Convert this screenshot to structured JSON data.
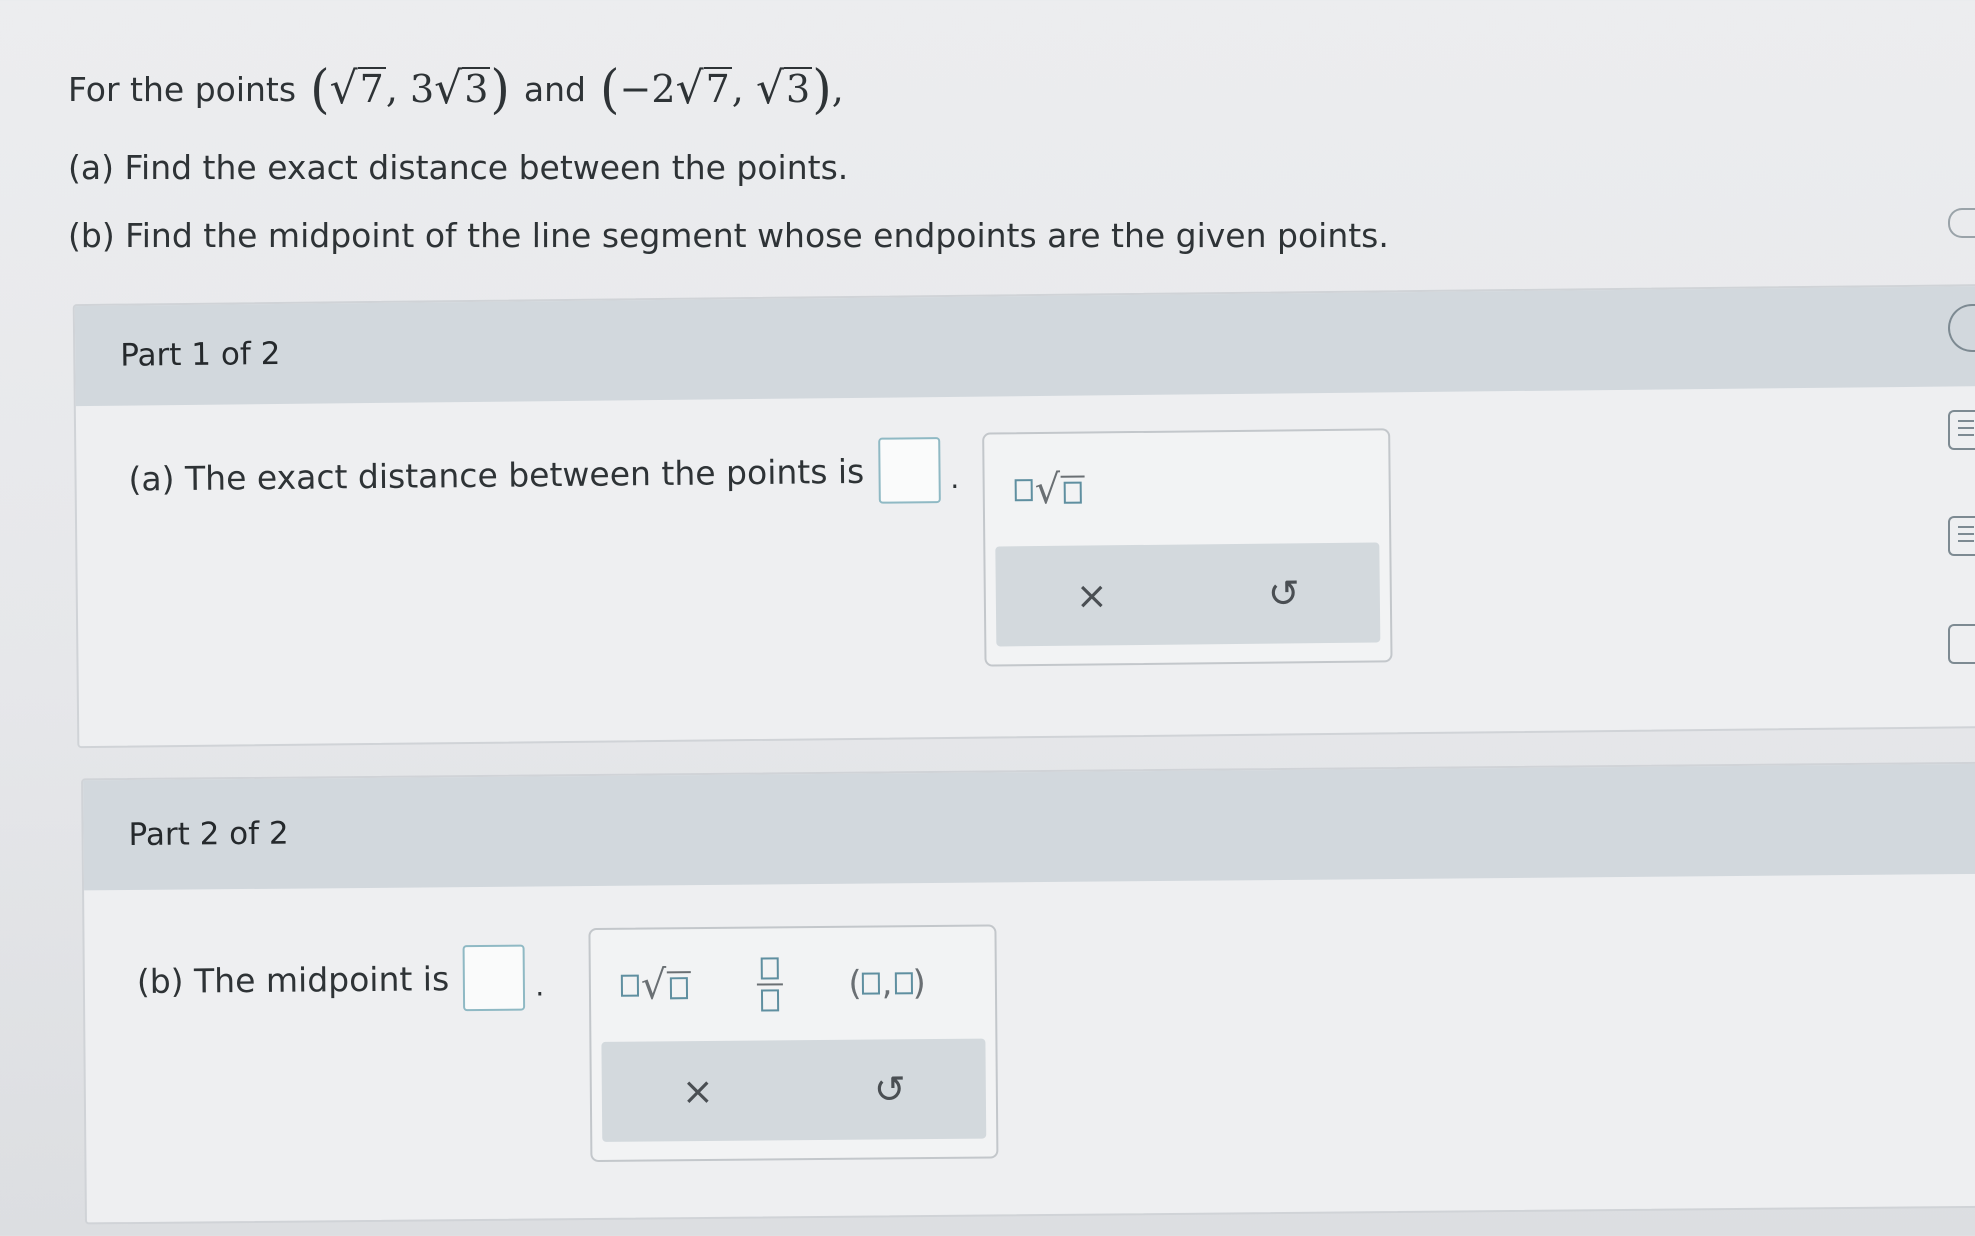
{
  "problem": {
    "intro": "For the points",
    "point1": {
      "x_root": "7",
      "y_coef": "3",
      "y_root": "3"
    },
    "connector": "and",
    "point2": {
      "x_coef": "−2",
      "x_root": "7",
      "y_root": "3"
    },
    "part_a_prompt": "(a) Find the exact distance between the points.",
    "part_b_prompt": "(b) Find the midpoint of the line segment whose endpoints are the given points."
  },
  "part1": {
    "header": "Part 1 of 2",
    "question": "(a) The exact distance between the points is",
    "answer_value": "",
    "palette": {
      "templates": [
        "sqrt-template-icon"
      ],
      "actions": {
        "clear": "×",
        "undo": "↺"
      }
    }
  },
  "part2": {
    "header": "Part 2 of 2",
    "question": "(b) The midpoint is",
    "answer_value": "",
    "palette": {
      "templates": [
        "sqrt-template-icon",
        "fraction-template-icon",
        "ordered-pair-template-icon"
      ],
      "actions": {
        "clear": "×",
        "undo": "↺"
      }
    }
  },
  "colors": {
    "header_bg": "#d2d8dd",
    "answer_border": "#8fb9c4",
    "template_accent": "#5f8fa0"
  }
}
